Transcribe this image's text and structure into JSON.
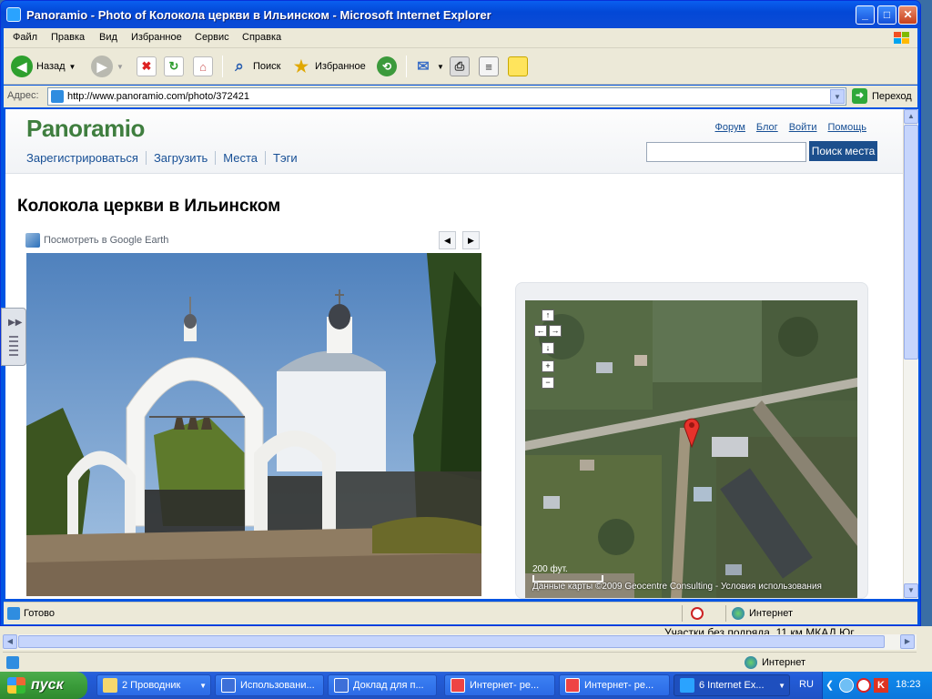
{
  "window": {
    "title": "Panoramio - Photo of Колокола церкви в Ильинском - Microsoft Internet Explorer",
    "minimize": "_",
    "maximize": "□",
    "close": "✕"
  },
  "menu": [
    "Файл",
    "Правка",
    "Вид",
    "Избранное",
    "Сервис",
    "Справка"
  ],
  "toolbar": {
    "back_label": "Назад",
    "search_label": "Поиск",
    "favorites_label": "Избранное"
  },
  "address": {
    "label": "Адрес:",
    "url": "http://www.panoramio.com/photo/372421",
    "go_label": "Переход"
  },
  "site": {
    "logo": "Panoramio",
    "nav": [
      "Зарегистрироваться",
      "Загрузить",
      "Места",
      "Тэги"
    ],
    "top_links": [
      "Форум",
      "Блог",
      "Войти",
      "Помощь"
    ],
    "search_button": "Поиск места",
    "search_value": ""
  },
  "photo_page": {
    "title": "Колокола церкви в Ильинском",
    "google_earth_link": "Посмотреть в Google Earth",
    "prev": "◀",
    "next": "▶"
  },
  "map": {
    "scale_label": "200 фут.",
    "copyright": "Данные карты ©2009 Geocentre Consulting - Условия использования"
  },
  "status": {
    "text": "Готово",
    "zone": "Интернет"
  },
  "background_window": {
    "text": "Участки без подряда, 11 км МКАД Юг",
    "zone": "Интернет"
  },
  "taskbar": {
    "start": "пуск",
    "tasks": [
      "2 Проводник",
      "Использовани...",
      "Доклад для п...",
      "Интернет- ре...",
      "Интернет- ре...",
      "6 Internet Ex..."
    ],
    "lang": "RU",
    "clock": "18:23"
  }
}
